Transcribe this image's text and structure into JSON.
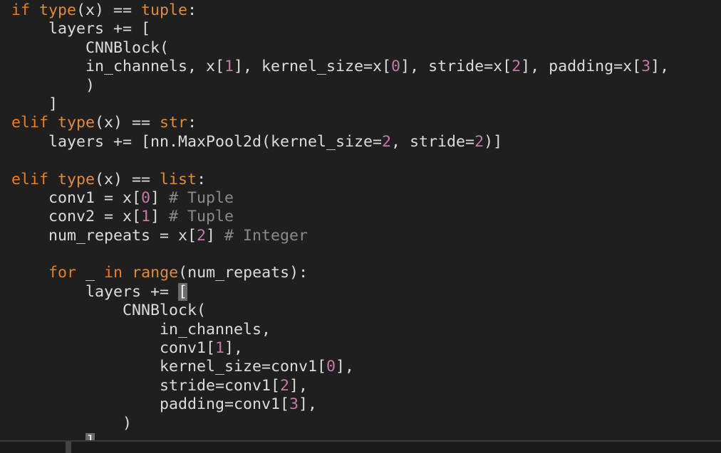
{
  "editor": {
    "language": "python",
    "theme_colors": {
      "background": "#1f1f1f",
      "keyword": "#e67e22",
      "builtin": "#e08a3a",
      "number": "#c678a8",
      "comment": "#8a8a8a",
      "text": "#dcdcdc"
    },
    "lines": [
      [
        {
          "t": "keyword",
          "v": "if "
        },
        {
          "t": "builtin",
          "v": "type"
        },
        {
          "t": "plain",
          "v": "(x) == "
        },
        {
          "t": "builtin",
          "v": "tuple"
        },
        {
          "t": "plain",
          "v": ":"
        }
      ],
      [
        {
          "t": "plain",
          "v": "    layers += ["
        }
      ],
      [
        {
          "t": "plain",
          "v": "        CNNBlock("
        }
      ],
      [
        {
          "t": "plain",
          "v": "        in_channels, x["
        },
        {
          "t": "number",
          "v": "1"
        },
        {
          "t": "plain",
          "v": "], kernel_size=x["
        },
        {
          "t": "number",
          "v": "0"
        },
        {
          "t": "plain",
          "v": "], stride=x["
        },
        {
          "t": "number",
          "v": "2"
        },
        {
          "t": "plain",
          "v": "], padding=x["
        },
        {
          "t": "number",
          "v": "3"
        },
        {
          "t": "plain",
          "v": "],"
        }
      ],
      [
        {
          "t": "plain",
          "v": "        )"
        }
      ],
      [
        {
          "t": "plain",
          "v": "    ]"
        }
      ],
      [
        {
          "t": "keyword",
          "v": "elif "
        },
        {
          "t": "builtin",
          "v": "type"
        },
        {
          "t": "plain",
          "v": "(x) == "
        },
        {
          "t": "builtin",
          "v": "str"
        },
        {
          "t": "plain",
          "v": ":"
        }
      ],
      [
        {
          "t": "plain",
          "v": "    layers += [nn.MaxPool2d(kernel_size="
        },
        {
          "t": "number",
          "v": "2"
        },
        {
          "t": "plain",
          "v": ", stride="
        },
        {
          "t": "number",
          "v": "2"
        },
        {
          "t": "plain",
          "v": ")]"
        }
      ],
      [
        {
          "t": "plain",
          "v": ""
        }
      ],
      [
        {
          "t": "keyword",
          "v": "elif "
        },
        {
          "t": "builtin",
          "v": "type"
        },
        {
          "t": "plain",
          "v": "(x) == "
        },
        {
          "t": "builtin",
          "v": "list"
        },
        {
          "t": "plain",
          "v": ":"
        }
      ],
      [
        {
          "t": "plain",
          "v": "    conv1 = x["
        },
        {
          "t": "number",
          "v": "0"
        },
        {
          "t": "plain",
          "v": "] "
        },
        {
          "t": "comment",
          "v": "# Tuple"
        }
      ],
      [
        {
          "t": "plain",
          "v": "    conv2 = x["
        },
        {
          "t": "number",
          "v": "1"
        },
        {
          "t": "plain",
          "v": "] "
        },
        {
          "t": "comment",
          "v": "# Tuple"
        }
      ],
      [
        {
          "t": "plain",
          "v": "    num_repeats = x["
        },
        {
          "t": "number",
          "v": "2"
        },
        {
          "t": "plain",
          "v": "] "
        },
        {
          "t": "comment",
          "v": "# Integer"
        }
      ],
      [
        {
          "t": "plain",
          "v": ""
        }
      ],
      [
        {
          "t": "keyword",
          "v": "    for"
        },
        {
          "t": "plain",
          "v": " _ "
        },
        {
          "t": "keyword",
          "v": "in"
        },
        {
          "t": "plain",
          "v": " "
        },
        {
          "t": "builtin",
          "v": "range"
        },
        {
          "t": "plain",
          "v": "(num_repeats):"
        }
      ],
      [
        {
          "t": "plain",
          "v": "        layers += "
        },
        {
          "t": "cursor",
          "v": "["
        }
      ],
      [
        {
          "t": "plain",
          "v": "            CNNBlock("
        }
      ],
      [
        {
          "t": "plain",
          "v": "                in_channels,"
        }
      ],
      [
        {
          "t": "plain",
          "v": "                conv1["
        },
        {
          "t": "number",
          "v": "1"
        },
        {
          "t": "plain",
          "v": "],"
        }
      ],
      [
        {
          "t": "plain",
          "v": "                kernel_size=conv1["
        },
        {
          "t": "number",
          "v": "0"
        },
        {
          "t": "plain",
          "v": "],"
        }
      ],
      [
        {
          "t": "plain",
          "v": "                stride=conv1["
        },
        {
          "t": "number",
          "v": "2"
        },
        {
          "t": "plain",
          "v": "],"
        }
      ],
      [
        {
          "t": "plain",
          "v": "                padding=conv1["
        },
        {
          "t": "number",
          "v": "3"
        },
        {
          "t": "plain",
          "v": "],"
        }
      ],
      [
        {
          "t": "plain",
          "v": "            )"
        }
      ],
      [
        {
          "t": "plain",
          "v": "        "
        },
        {
          "t": "cursor",
          "v": "]"
        }
      ]
    ]
  }
}
